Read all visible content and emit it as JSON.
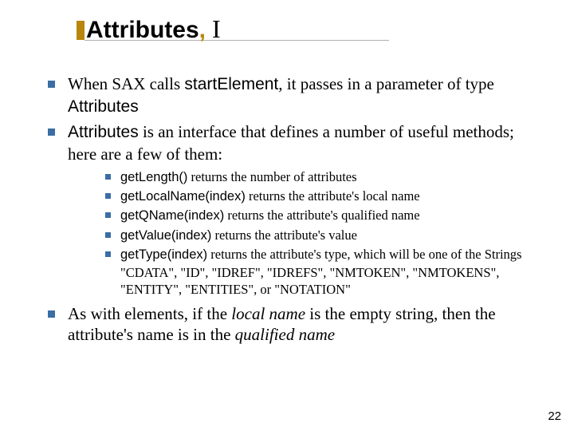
{
  "title": {
    "main": "Attributes",
    "comma": ",",
    "suffix": " I"
  },
  "bullets": {
    "b1": {
      "pre": "When SAX calls ",
      "code": "startElement",
      "mid": ", it passes in a parameter of type ",
      "code2": "Attributes"
    },
    "b2": {
      "code": "Attributes",
      "post": " is an interface that defines a number of useful methods; here are a few of them:"
    },
    "b3": {
      "pre": "As with elements, if the ",
      "em1": "local name",
      "mid": " is the empty string, then the attribute's name is in the ",
      "em2": "qualified name"
    }
  },
  "subs": {
    "s1": {
      "code": "getLength()",
      "rest": " returns the number of attributes"
    },
    "s2": {
      "code": "getLocalName(index)",
      "rest": " returns the attribute's local name"
    },
    "s3": {
      "code": "getQName(index)",
      "rest": " returns the attribute's qualified name"
    },
    "s4": {
      "code": "getValue(index)",
      "rest": " returns the attribute's value"
    },
    "s5": {
      "code": "getType(index)",
      "rest": " returns the attribute's type, which will be one of the Strings  \"CDATA\", \"ID\", \"IDREF\", \"IDREFS\", \"NMTOKEN\", \"NMTOKENS\", \"ENTITY\", \"ENTITIES\", or \"NOTATION\""
    }
  },
  "page_number": "22"
}
